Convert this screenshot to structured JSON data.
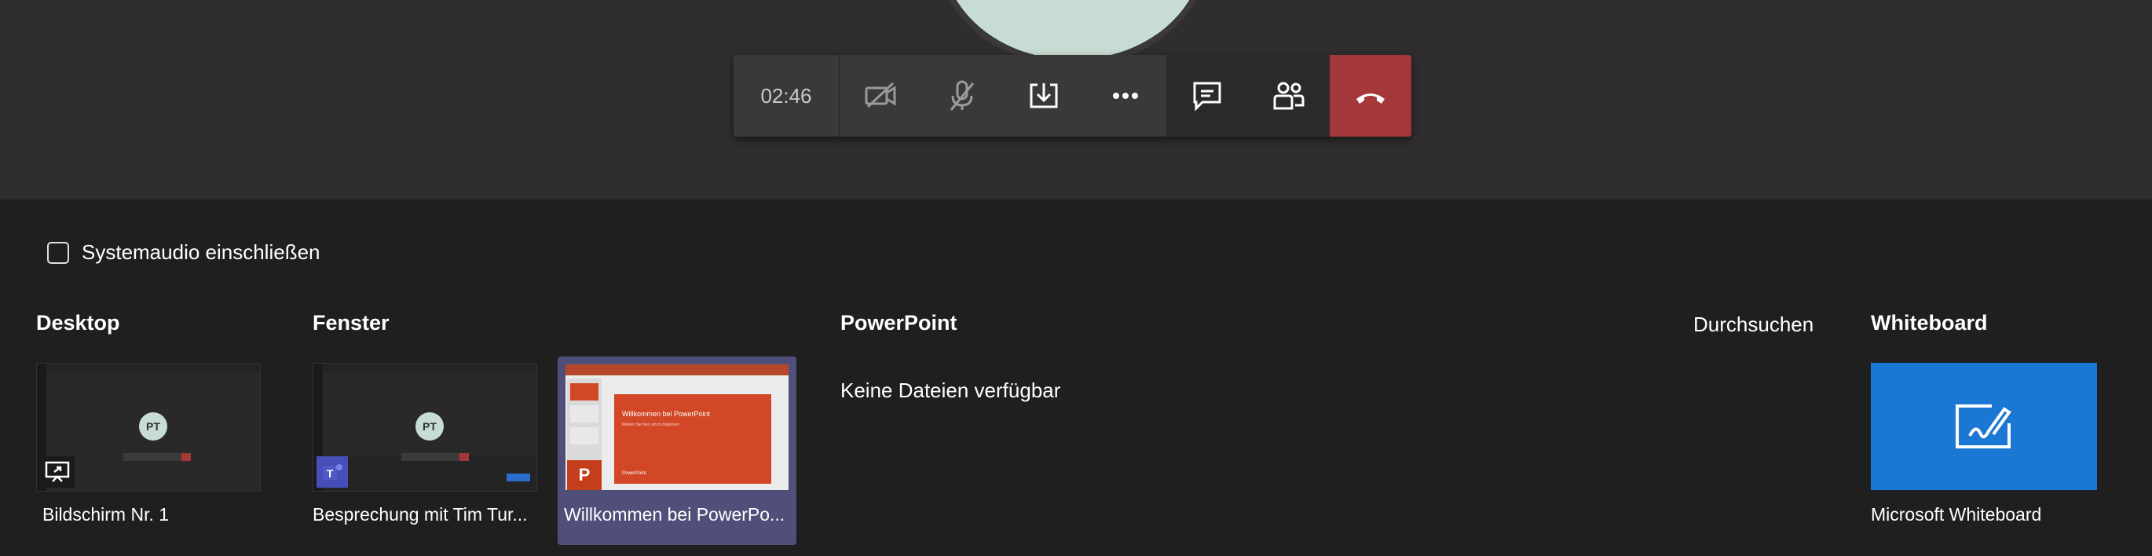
{
  "call": {
    "timer": "02:46",
    "buttons": [
      "camera-off-icon",
      "mic-off-icon",
      "share-tray-icon",
      "more-icon",
      "chat-icon",
      "participants-icon",
      "hang-up-icon"
    ]
  },
  "share": {
    "system_audio_label": "Systemaudio einschließen",
    "sections": {
      "desktop": "Desktop",
      "window": "Fenster",
      "powerpoint": "PowerPoint",
      "browse": "Durchsuchen",
      "whiteboard": "Whiteboard"
    },
    "desktop_item": {
      "label": "Bildschirm Nr. 1",
      "avatar": "PT"
    },
    "window_items": [
      {
        "label": "Besprechung mit Tim Tur...",
        "avatar": "PT"
      },
      {
        "label": "Willkommen bei PowerPo...",
        "slide_title": "Willkommen bei PowerPoint",
        "slide_footer": "PowerPoint",
        "app_letter": "P"
      }
    ],
    "powerpoint_empty": "Keine Dateien verfügbar",
    "whiteboard_item": {
      "label": "Microsoft Whiteboard"
    }
  },
  "colors": {
    "hangup": "#a4373a",
    "selected": "#4f4f7a",
    "whiteboard": "#1a78d4",
    "powerpoint": "#d24726"
  }
}
